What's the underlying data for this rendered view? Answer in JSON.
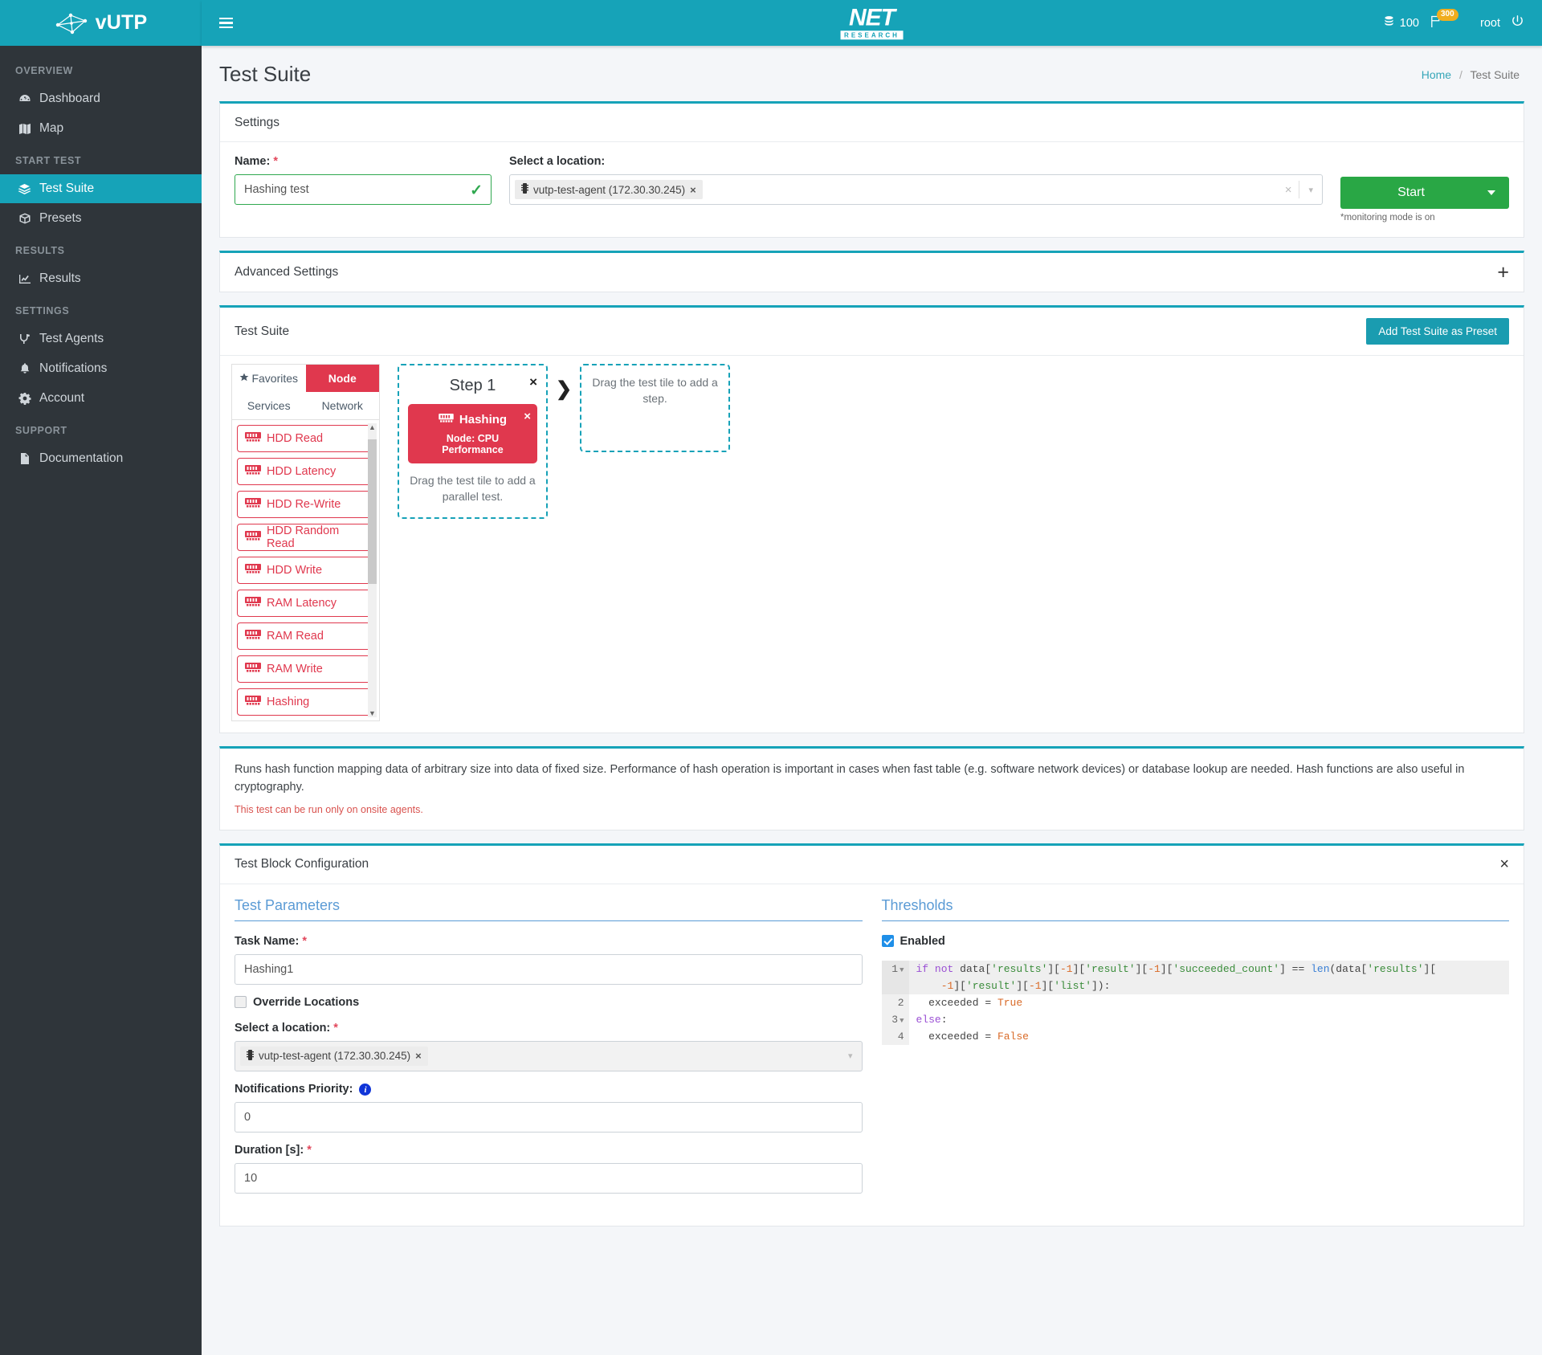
{
  "brand": {
    "name": "vUTP",
    "logo_icon": "network-nodes-icon"
  },
  "topbar": {
    "menu_icon": "hamburger-icon",
    "logo_main": "NET",
    "logo_sub": "RESEARCH",
    "credits_icon": "coins-icon",
    "credits": "100",
    "flag_icon": "flag-icon",
    "flag_badge": "300",
    "avatar_icon": "user-avatar",
    "username": "root",
    "logout_icon": "power-icon"
  },
  "sidebar": {
    "groups": [
      {
        "title": "OVERVIEW",
        "items": [
          {
            "label": "Dashboard",
            "icon": "dashboard-icon",
            "active": false
          },
          {
            "label": "Map",
            "icon": "map-icon",
            "active": false
          }
        ]
      },
      {
        "title": "START TEST",
        "items": [
          {
            "label": "Test Suite",
            "icon": "test-suite-icon",
            "active": true
          },
          {
            "label": "Presets",
            "icon": "box-icon",
            "active": false
          }
        ]
      },
      {
        "title": "RESULTS",
        "items": [
          {
            "label": "Results",
            "icon": "chart-icon",
            "active": false
          }
        ]
      },
      {
        "title": "SETTINGS",
        "items": [
          {
            "label": "Test Agents",
            "icon": "agents-icon",
            "active": false
          },
          {
            "label": "Notifications",
            "icon": "bell-icon",
            "active": false
          },
          {
            "label": "Account",
            "icon": "gear-icon",
            "active": false
          }
        ]
      },
      {
        "title": "SUPPORT",
        "items": [
          {
            "label": "Documentation",
            "icon": "document-icon",
            "active": false
          }
        ]
      }
    ]
  },
  "page": {
    "title": "Test Suite",
    "breadcrumb_home": "Home",
    "breadcrumb_sep": "/",
    "breadcrumb_current": "Test Suite"
  },
  "settings": {
    "card_title": "Settings",
    "name_label": "Name:",
    "name_value": "Hashing test",
    "name_valid_icon": "check-icon",
    "location_label": "Select a location:",
    "location_chip": "vutp-test-agent (172.30.30.245)",
    "location_chip_remove": "×",
    "clear_icon": "×",
    "caret_icon": "∨",
    "start_label": "Start",
    "start_caret_icon": "caret-down-icon",
    "monitoring_note": "*monitoring mode is on"
  },
  "advanced": {
    "title": "Advanced Settings",
    "expand_icon": "+"
  },
  "suite": {
    "title": "Test Suite",
    "preset_button": "Add Test Suite as Preset",
    "tabs": [
      {
        "label": "Favorites",
        "icon": "star-icon",
        "selected": false
      },
      {
        "label": "Node",
        "icon": "",
        "selected": true
      },
      {
        "label": "Services",
        "icon": "",
        "selected": false
      },
      {
        "label": "Network",
        "icon": "",
        "selected": false
      }
    ],
    "tiles": [
      {
        "label": "HDD Read",
        "icon": "ram-chip-icon"
      },
      {
        "label": "HDD Latency",
        "icon": "ram-chip-icon"
      },
      {
        "label": "HDD Re-Write",
        "icon": "ram-chip-icon"
      },
      {
        "label": "HDD Random Read",
        "icon": "ram-chip-icon"
      },
      {
        "label": "HDD Write",
        "icon": "ram-chip-icon"
      },
      {
        "label": "RAM Latency",
        "icon": "ram-chip-icon"
      },
      {
        "label": "RAM Read",
        "icon": "ram-chip-icon"
      },
      {
        "label": "RAM Write",
        "icon": "ram-chip-icon"
      },
      {
        "label": "Hashing",
        "icon": "ram-chip-icon"
      }
    ],
    "step": {
      "title": "Step 1",
      "close_icon": "×",
      "test_name": "Hashing",
      "test_icon": "ram-chip-icon",
      "test_remove_icon": "×",
      "test_node": "Node: CPU Performance",
      "parallel_hint": "Drag the test tile to add a parallel test."
    },
    "arrow_icon": "chevron-right-icon",
    "dropzone_hint": "Drag the test tile to add a step."
  },
  "description": {
    "text": "Runs hash function mapping data of arbitrary size into data of fixed size. Performance of hash operation is important in cases when fast table (e.g. software network devices) or database lookup are needed. Hash functions are also useful in cryptography.",
    "warning": "This test can be run only on onsite agents."
  },
  "config": {
    "title": "Test Block Configuration",
    "close_icon": "×",
    "params_heading": "Test Parameters",
    "task_name_label": "Task Name:",
    "task_name_value": "Hashing1",
    "override_label": "Override Locations",
    "override_checked": false,
    "location_label": "Select a location:",
    "location_chip": "vutp-test-agent (172.30.30.245)",
    "location_chip_remove": "×",
    "caret_icon": "∨",
    "priority_label": "Notifications Priority:",
    "priority_info_icon": "info-icon",
    "priority_value": "0",
    "duration_label": "Duration [s]:",
    "duration_value": "10",
    "thresholds_heading": "Thresholds",
    "enabled_label": "Enabled",
    "enabled_checked": true,
    "code_lines": [
      {
        "num": "1",
        "foldable": true,
        "highlighted": true
      },
      {
        "num": "",
        "foldable": false,
        "highlighted": true
      },
      {
        "num": "2",
        "foldable": false,
        "highlighted": false
      },
      {
        "num": "3",
        "foldable": true,
        "highlighted": false
      },
      {
        "num": "4",
        "foldable": false,
        "highlighted": false
      }
    ],
    "code_text": "if not data['results'][-1]['result'][-1]['succeeded_count'] == len(data['results'][\n    -1]['result'][-1]['list']):\n  exceeded = True\nelse:\n  exceeded = False"
  },
  "colors": {
    "brand_teal": "#16a3b8",
    "sidebar_dark": "#2f353a",
    "accent_red": "#e0384e",
    "start_green": "#29a745",
    "link_blue": "#5b9bd5",
    "badge_orange": "#f0ad1e"
  }
}
